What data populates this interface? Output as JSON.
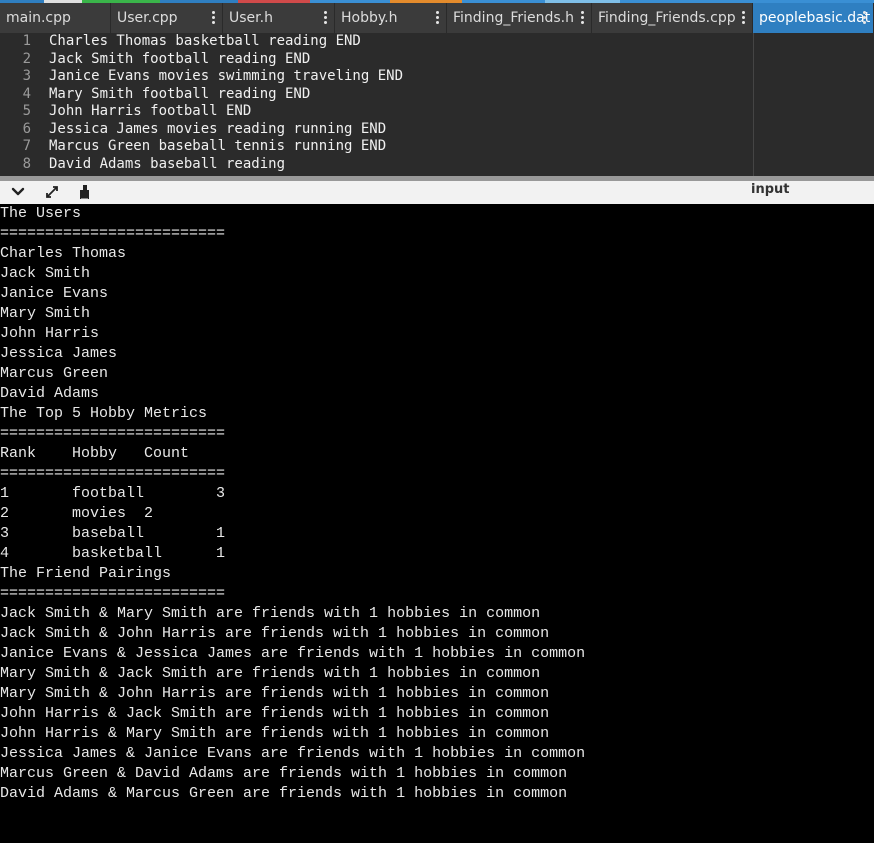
{
  "tabs": [
    {
      "label": "main.cpp",
      "active": false,
      "menu": false
    },
    {
      "label": "User.cpp",
      "active": false,
      "menu": true
    },
    {
      "label": "User.h",
      "active": false,
      "menu": true
    },
    {
      "label": "Hobby.h",
      "active": false,
      "menu": true
    },
    {
      "label": "Finding_Friends.h",
      "active": false,
      "menu": true
    },
    {
      "label": "Finding_Friends.cpp",
      "active": false,
      "menu": true
    },
    {
      "label": "peoplebasic.dat",
      "active": true,
      "menu": true
    }
  ],
  "tab_strip_colors": [
    "#2f7fc1",
    "#e0e0e0",
    "#3ab54a",
    "#2f7fc1",
    "#d04a4a",
    "#3a8fd4",
    "#e38b2c",
    "#3a8fd4",
    "#7fbfe8",
    "#3a8fd4"
  ],
  "editor": {
    "lines": [
      {
        "n": "1",
        "text": "Charles Thomas basketball reading END"
      },
      {
        "n": "2",
        "text": "Jack Smith football reading END"
      },
      {
        "n": "3",
        "text": "Janice Evans movies swimming traveling END"
      },
      {
        "n": "4",
        "text": "Mary Smith football reading END"
      },
      {
        "n": "5",
        "text": "John Harris football END"
      },
      {
        "n": "6",
        "text": "Jessica James movies reading running END"
      },
      {
        "n": "7",
        "text": "Marcus Green baseball tennis running END"
      },
      {
        "n": "8",
        "text": "David Adams baseball reading"
      }
    ]
  },
  "panel": {
    "title": "input",
    "buttons": [
      "chevron-down-icon",
      "expand-icon",
      "clear-icon"
    ]
  },
  "console": {
    "lines": [
      {
        "t": "The Users"
      },
      {
        "t": "========================="
      },
      {
        "t": "Charles Thomas"
      },
      {
        "t": "Jack Smith"
      },
      {
        "t": "Janice Evans"
      },
      {
        "t": "Mary Smith"
      },
      {
        "t": "John Harris"
      },
      {
        "t": "Jessica James"
      },
      {
        "t": "Marcus Green"
      },
      {
        "t": "David Adams"
      },
      {
        "t": "The Top 5 Hobby Metrics"
      },
      {
        "t": "========================="
      },
      {
        "cols": [
          "Rank",
          "Hobby",
          "Count"
        ]
      },
      {
        "t": "========================="
      },
      {
        "cols": [
          "1",
          "football",
          "3"
        ]
      },
      {
        "cols": [
          "2",
          "movies  2",
          ""
        ]
      },
      {
        "cols": [
          "3",
          "baseball",
          "1"
        ]
      },
      {
        "cols": [
          "4",
          "basketball",
          "1"
        ]
      },
      {
        "t": "The Friend Pairings"
      },
      {
        "t": "========================="
      },
      {
        "t": "Jack Smith & Mary Smith are friends with 1 hobbies in common"
      },
      {
        "t": "Jack Smith & John Harris are friends with 1 hobbies in common"
      },
      {
        "t": "Janice Evans & Jessica James are friends with 1 hobbies in common"
      },
      {
        "t": "Mary Smith & Jack Smith are friends with 1 hobbies in common"
      },
      {
        "t": "Mary Smith & John Harris are friends with 1 hobbies in common"
      },
      {
        "t": "John Harris & Jack Smith are friends with 1 hobbies in common"
      },
      {
        "t": "John Harris & Mary Smith are friends with 1 hobbies in common"
      },
      {
        "t": "Jessica James & Janice Evans are friends with 1 hobbies in common"
      },
      {
        "t": "Marcus Green & David Adams are friends with 1 hobbies in common"
      },
      {
        "t": "David Adams & Marcus Green are friends with 1 hobbies in common"
      }
    ]
  }
}
